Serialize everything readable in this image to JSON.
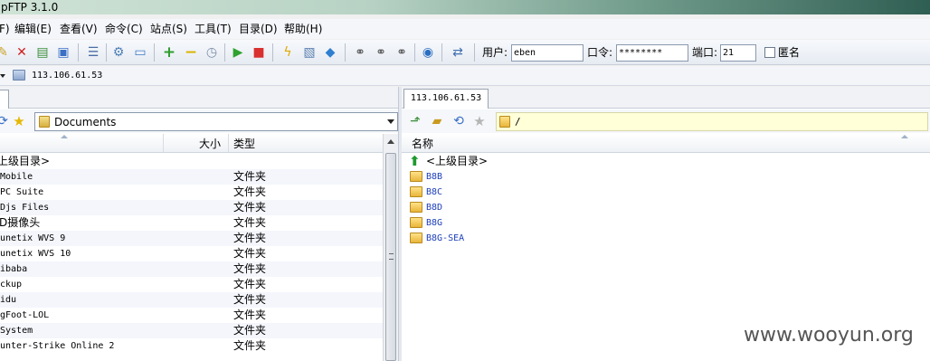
{
  "app": {
    "title": "pFTP 3.1.0"
  },
  "menu": [
    "F)",
    "编辑(E)",
    "查看(V)",
    "命令(C)",
    "站点(S)",
    "工具(T)",
    "目录(D)",
    "帮助(H)"
  ],
  "toolbar": {
    "icons": [
      "connect-icon",
      "disconnect-icon",
      "site-manager-icon",
      "quick-connect-icon",
      "queue-icon",
      "settings-icon",
      "window-icon",
      "add-icon",
      "remove-icon",
      "clock-icon",
      "play-icon",
      "stop-icon",
      "lightning-icon",
      "image-icon",
      "diamond-icon",
      "search-binoculars-icon",
      "search-next-icon",
      "search-prev-icon",
      "globe-icon",
      "refresh-icon"
    ],
    "user_label": "用户:",
    "user_value": "eben",
    "password_label": "口令:",
    "password_value": "********",
    "port_label": "端口:",
    "port_value": "21",
    "anonymous_label": "匿名"
  },
  "quickbar": {
    "address": "113.106.61.53"
  },
  "left": {
    "path": "Documents",
    "columns": {
      "name": "",
      "size": "大小",
      "type": "类型"
    },
    "rows": [
      {
        "name": "上级目录>",
        "type": ""
      },
      {
        "name": " Mobile",
        "type": "文件夹"
      },
      {
        "name": " PC Suite",
        "type": "文件夹"
      },
      {
        "name": "Djs Files",
        "type": "文件夹"
      },
      {
        "name": "D摄像头",
        "type": "文件夹"
      },
      {
        "name": "unetix WVS 9",
        "type": "文件夹"
      },
      {
        "name": "unetix WVS 10",
        "type": "文件夹"
      },
      {
        "name": "ibaba",
        "type": "文件夹"
      },
      {
        "name": "ckup",
        "type": "文件夹"
      },
      {
        "name": "idu",
        "type": "文件夹"
      },
      {
        "name": "gFoot-LOL",
        "type": "文件夹"
      },
      {
        "name": "System",
        "type": "文件夹"
      },
      {
        "name": "unter-Strike Online 2",
        "type": "文件夹"
      }
    ]
  },
  "right": {
    "tab": "113.106.61.53",
    "path": "/",
    "columns": {
      "name": "名称"
    },
    "parent": "<上级目录>",
    "rows": [
      "B8B",
      "B8C",
      "B8D",
      "B8G",
      "B8G-SEA"
    ]
  },
  "watermark": "www.wooyun.org"
}
